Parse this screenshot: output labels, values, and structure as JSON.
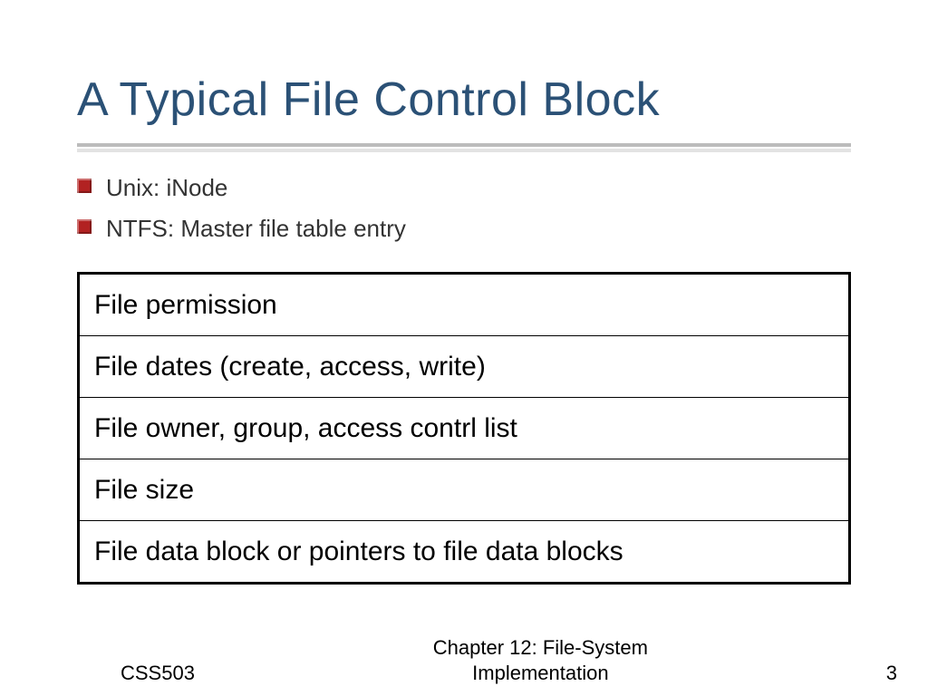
{
  "title": "A Typical File Control Block",
  "bullets": [
    "Unix: iNode",
    "NTFS: Master file table entry"
  ],
  "table_rows": [
    "File permission",
    "File dates (create, access, write)",
    "File owner, group, access contrl list",
    "File size",
    "File data block or pointers to file data blocks"
  ],
  "footer": {
    "left": "CSS503",
    "center_line1": "Chapter 12: File-System",
    "center_line2": "Implementation",
    "right": "3"
  }
}
